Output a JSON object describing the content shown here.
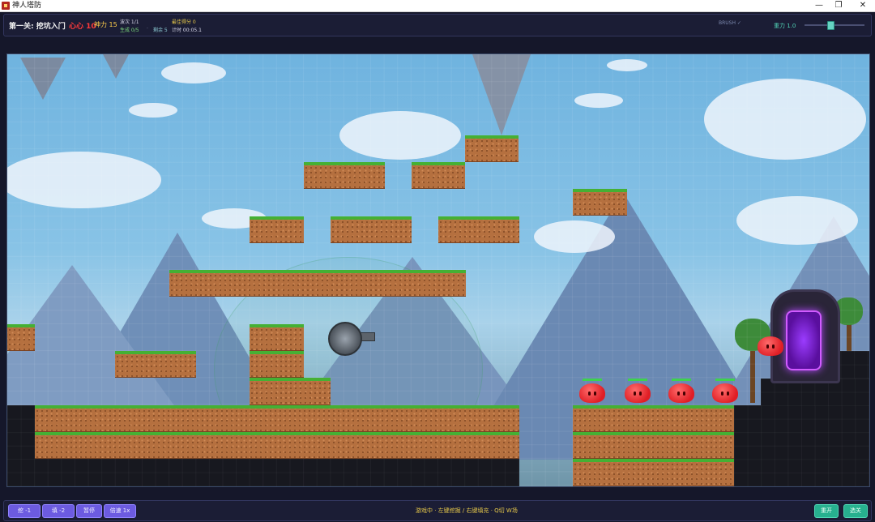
{
  "window": {
    "title": "神人塔防",
    "controls": [
      "—",
      "❐",
      "✕"
    ]
  },
  "hud": {
    "level": "第一关: 挖坑入门",
    "hearts": "心心 10",
    "power": "神力 15",
    "wave": "波次 1/1",
    "best": "最佳得分 0",
    "generated": "生成 0/5",
    "separator": "·",
    "remaining": "剩余 5",
    "timer": "计时 00:05.1",
    "brush": "BRUSH ✓",
    "gravity": "重力 1.0",
    "gravity_value": 0.5
  },
  "game": {
    "enemies": [
      {
        "type": "red-slime"
      },
      {
        "type": "red-slime"
      },
      {
        "type": "red-slime"
      },
      {
        "type": "red-slime"
      },
      {
        "type": "red-slime"
      }
    ],
    "turret": "cannon",
    "portal": "purple-portal"
  },
  "toolbar": {
    "dig_label": "挖 -1",
    "fill_label": "填 -2",
    "pause_label": "暂停",
    "speed_label": "倍速 1x",
    "status": "游戏中 · 左键挖掘 / 右键填充 · Q切 W场",
    "restart_label": "重开",
    "select_label": "选关"
  },
  "colors": {
    "grass": "#45b034",
    "dirt": "#b5703f",
    "slime": "#e01e25",
    "portal": "#9b3cff",
    "accent": "#6c5be0",
    "teal": "#27b08f"
  }
}
